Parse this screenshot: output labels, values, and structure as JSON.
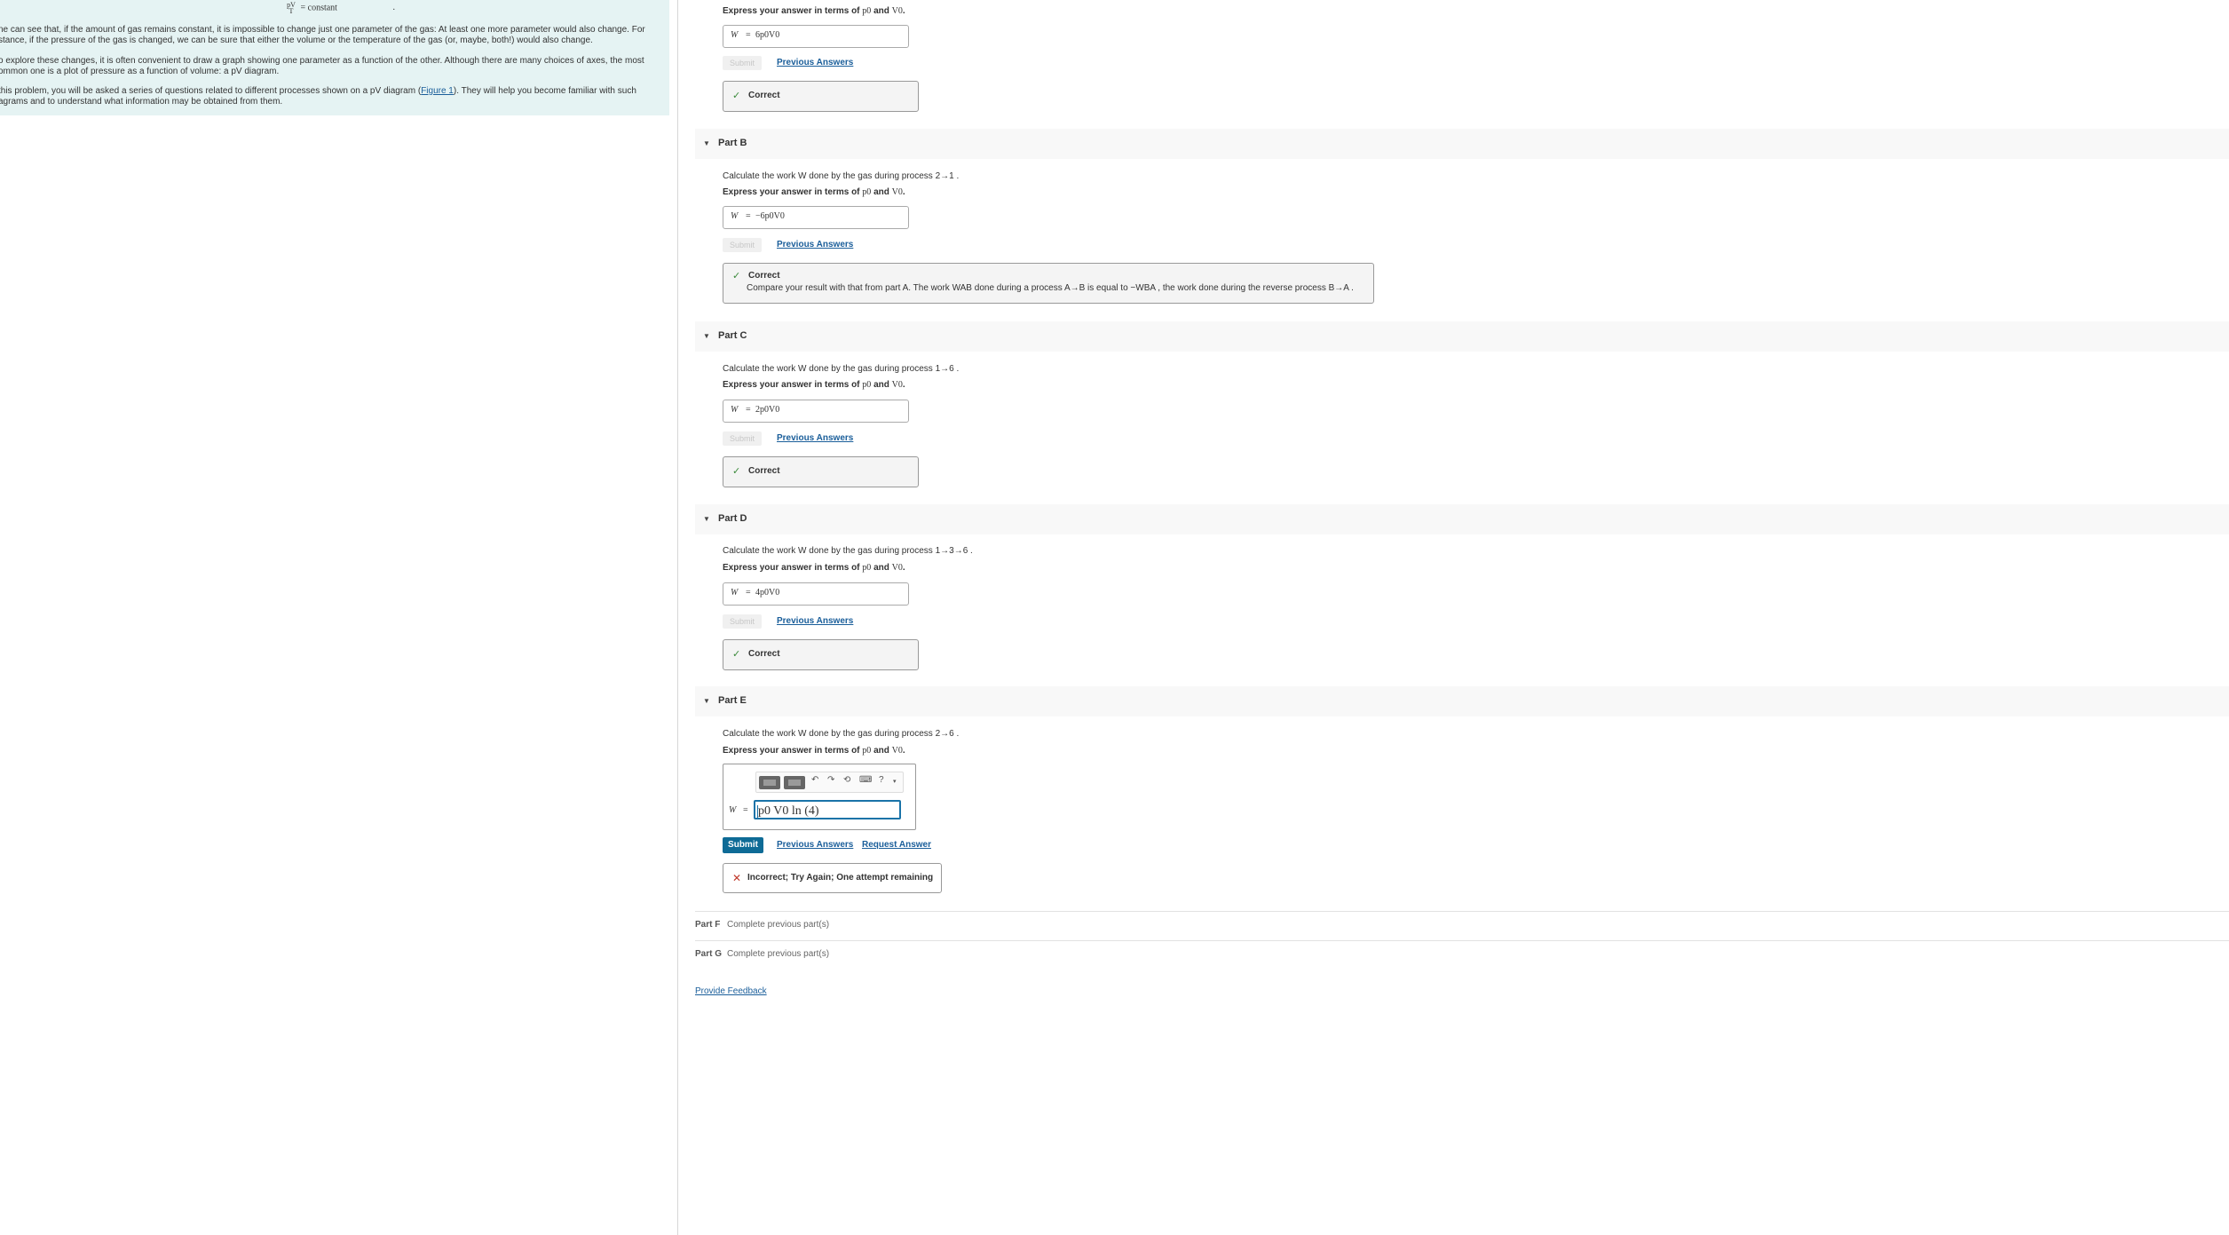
{
  "intro": {
    "equation_frac_top": "pV",
    "equation_frac_bottom": "T",
    "equation_rhs": "= constant",
    "equation_tail": ".",
    "para1_line1": "ne can see that, if the amount of gas remains constant, it is impossible to change just one parameter of the gas: At least one more parameter would also change. For",
    "para1_line2": "stance, if the pressure of the gas is changed, we can be sure that either the volume or the temperature of the gas (or, maybe, both!) would also change.",
    "para2_line1": "o explore these changes, it is often convenient to draw a graph showing one parameter as a function of the other. Although there are many choices of axes, the most",
    "para2_line2": "ommon one is a plot of pressure as a function of volume: a pV diagram.",
    "para3_line1_a": " this problem, you will be asked a series of questions related to different processes shown on a pV diagram (",
    "para3_figure_link": "Figure 1",
    "para3_line1_b": "). They will help you become familiar with such",
    "para3_line2": "agrams and to understand what information may be obtained from them."
  },
  "partA": {
    "express": "Express your answer in terms of",
    "v1": "p0",
    "and": "and",
    "v2": "V0",
    "answer_lhs": "W",
    "answer_eq": "=",
    "answer_rhs": "6p0V0",
    "submit": "Submit",
    "prev_answers": "Previous Answers",
    "feedback": "Correct"
  },
  "partB": {
    "title": "Part B",
    "question": "Calculate the work W  done by the gas during process 2→1 .",
    "express": "Express your answer in terms of",
    "v1": "p0",
    "and": "and",
    "v2": "V0",
    "answer_lhs": "W",
    "answer_eq": "=",
    "answer_rhs": "−6p0V0",
    "submit": "Submit",
    "prev_answers": "Previous Answers",
    "feedback": "Correct",
    "feedback_detail": "Compare your result with that from part A. The work WAB done during a process A→B  is equal to −WBA , the work done during the reverse process B→A ."
  },
  "partC": {
    "title": "Part C",
    "question": "Calculate the work W  done by the gas during process 1→6 .",
    "express": "Express your answer in terms of",
    "v1": "p0",
    "and": "and",
    "v2": "V0",
    "answer_lhs": "W",
    "answer_eq": "=",
    "answer_rhs": "2p0V0",
    "submit": "Submit",
    "prev_answers": "Previous Answers",
    "feedback": "Correct"
  },
  "partD": {
    "title": "Part D",
    "question": "Calculate the work W  done by the gas during process 1→3→6 .",
    "express": "Express your answer in terms of",
    "v1": "p0",
    "and": "and",
    "v2": "V0",
    "answer_lhs": "W",
    "answer_eq": "=",
    "answer_rhs": "4p0V0",
    "submit": "Submit",
    "prev_answers": "Previous Answers",
    "feedback": "Correct"
  },
  "partE": {
    "title": "Part E",
    "question": "Calculate the work W  done by the gas during process 2→6 .",
    "express": "Express your answer in terms of",
    "v1": "p0",
    "and": "and",
    "v2": "V0",
    "answer_lhs": "W",
    "answer_eq": "=",
    "input_value": "p0 V0 ln (4)",
    "submit": "Submit",
    "prev_answers": "Previous Answers",
    "request_answer": "Request Answer",
    "feedback": "Incorrect; Try Again; One attempt remaining"
  },
  "partF": {
    "title": "Part F",
    "status": "Complete previous part(s)"
  },
  "partG": {
    "title": "Part G",
    "status": "Complete previous part(s)"
  },
  "provide_feedback": "Provide Feedback",
  "icons": {
    "caret": "caret-down-icon",
    "check": "check-icon",
    "cross": "x-icon",
    "undo": "undo-icon",
    "redo": "redo-icon",
    "reset": "reset-icon",
    "keyboard": "keyboard-icon",
    "help": "help-icon"
  },
  "colors": {
    "intro_bg": "#e5f3f3",
    "link": "#1a5e9a",
    "submit_bg": "#0e6b96",
    "correct": "#3a8a3a",
    "incorrect": "#c0392b"
  }
}
